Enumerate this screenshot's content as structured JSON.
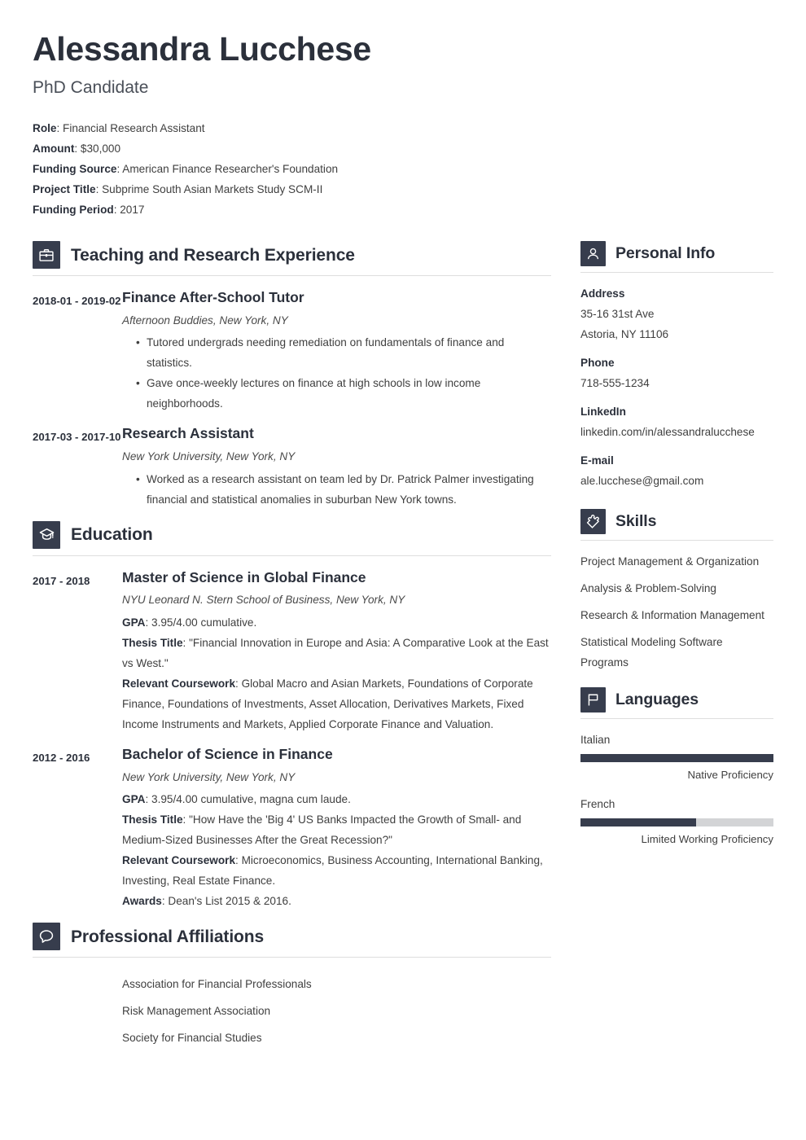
{
  "header": {
    "name": "Alessandra Lucchese",
    "job_title": "PhD Candidate",
    "details": [
      {
        "label": "Role",
        "value": "Financial Research Assistant"
      },
      {
        "label": "Amount",
        "value": "$30,000"
      },
      {
        "label": "Funding Source",
        "value": "American Finance Researcher's Foundation"
      },
      {
        "label": "Project Title",
        "value": "Subprime South Asian Markets Study SCM-II"
      },
      {
        "label": "Funding Period",
        "value": "2017"
      }
    ]
  },
  "sections": {
    "experience": {
      "title": "Teaching and Research Experience",
      "icon": "briefcase-icon",
      "entries": [
        {
          "dates": "2018-01 - 2019-02",
          "title": "Finance After-School Tutor",
          "subtitle": "Afternoon Buddies, New York, NY",
          "bullets": [
            "Tutored undergrads needing remediation on fundamentals of finance and statistics.",
            "Gave once-weekly lectures on finance at high schools in low income neighborhoods."
          ]
        },
        {
          "dates": "2017-03 - 2017-10",
          "title": "Research Assistant",
          "subtitle": "New York University, New York, NY",
          "bullets": [
            "Worked as a research assistant on team led by Dr. Patrick Palmer investigating financial and statistical anomalies in suburban New York towns."
          ]
        }
      ]
    },
    "education": {
      "title": "Education",
      "icon": "graduation-cap-icon",
      "entries": [
        {
          "dates": "2017 - 2018",
          "title": "Master of Science in Global Finance",
          "subtitle": "NYU Leonard N. Stern School of Business, New York, NY",
          "facts": [
            {
              "label": "GPA",
              "value": "3.95/4.00 cumulative."
            },
            {
              "label": "Thesis Title",
              "value": "\"Financial Innovation in Europe and Asia: A Comparative Look at the East vs West.\""
            },
            {
              "label": "Relevant Coursework",
              "value": "Global Macro and Asian Markets, Foundations of Corporate Finance, Foundations of Investments, Asset Allocation, Derivatives Markets, Fixed Income Instruments and Markets, Applied Corporate Finance and Valuation."
            }
          ]
        },
        {
          "dates": "2012 - 2016",
          "title": "Bachelor of Science in Finance",
          "subtitle": "New York University, New York, NY",
          "facts": [
            {
              "label": "GPA",
              "value": "3.95/4.00 cumulative, magna cum laude."
            },
            {
              "label": "Thesis Title",
              "value": "\"How Have the 'Big 4' US Banks Impacted the Growth of Small- and Medium-Sized Businesses After the Great Recession?\""
            },
            {
              "label": "Relevant Coursework",
              "value": "Microeconomics, Business Accounting, International Banking, Investing, Real Estate Finance."
            },
            {
              "label": "Awards",
              "value": "Dean's List 2015 & 2016."
            }
          ]
        }
      ]
    },
    "affiliations": {
      "title": "Professional Affiliations",
      "icon": "speech-bubble-icon",
      "items": [
        "Association for Financial Professionals",
        "Risk Management Association",
        "Society for Financial Studies"
      ]
    },
    "personal_info": {
      "title": "Personal Info",
      "icon": "person-icon",
      "groups": [
        {
          "label": "Address",
          "values": [
            "35-16 31st Ave",
            "Astoria, NY 11106"
          ]
        },
        {
          "label": "Phone",
          "values": [
            "718-555-1234"
          ]
        },
        {
          "label": "LinkedIn",
          "values": [
            "linkedin.com/in/alessandralucchese"
          ]
        },
        {
          "label": "E-mail",
          "values": [
            "ale.lucchese@gmail.com"
          ]
        }
      ]
    },
    "skills": {
      "title": "Skills",
      "icon": "puzzle-piece-icon",
      "items": [
        "Project Management & Organization",
        "Analysis & Problem-Solving",
        "Research & Information Management",
        "Statistical Modeling Software Programs"
      ]
    },
    "languages": {
      "title": "Languages",
      "icon": "flag-icon",
      "items": [
        {
          "name": "Italian",
          "level": "Native Proficiency",
          "percent": 100
        },
        {
          "name": "French",
          "level": "Limited Working Proficiency",
          "percent": 60
        }
      ]
    }
  },
  "colors": {
    "accent_dark": "#373d4d",
    "heading": "#2b303b",
    "bar_track": "#d3d4d6",
    "rule": "#dedede"
  }
}
